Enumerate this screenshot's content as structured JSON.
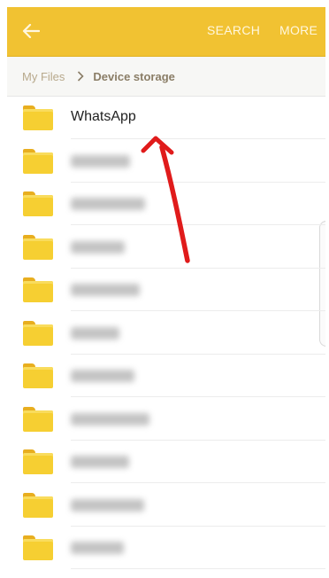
{
  "appbar": {
    "back_icon": "arrow-left-icon",
    "search_label": "SEARCH",
    "more_label": "MORE",
    "color": "#f1c232"
  },
  "breadcrumb": {
    "root": "My Files",
    "separator_icon": "chevron-right-icon",
    "current": "Device storage"
  },
  "folders": [
    {
      "name": "WhatsApp",
      "blurred": false
    },
    {
      "name": "",
      "blurred": true
    },
    {
      "name": "",
      "blurred": true
    },
    {
      "name": "",
      "blurred": true
    },
    {
      "name": "",
      "blurred": true
    },
    {
      "name": "",
      "blurred": true
    },
    {
      "name": "",
      "blurred": true
    },
    {
      "name": "",
      "blurred": true
    },
    {
      "name": "",
      "blurred": true
    },
    {
      "name": "",
      "blurred": true
    },
    {
      "name": "",
      "blurred": true
    }
  ],
  "annotation": {
    "icon": "red-arrow-icon",
    "color": "#e01b1b"
  },
  "folder_color": "#f6cf32"
}
